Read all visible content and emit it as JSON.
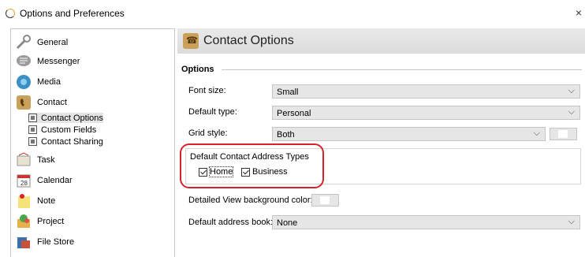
{
  "window": {
    "title": "Options and Preferences",
    "close_glyph": "×"
  },
  "sidebar": {
    "items": [
      {
        "label": "General",
        "icon": "wrench-icon"
      },
      {
        "label": "Messenger",
        "icon": "speech-bubble-icon"
      },
      {
        "label": "Media",
        "icon": "media-icon"
      },
      {
        "label": "Contact",
        "icon": "phone-book-icon"
      },
      {
        "label": "Task",
        "icon": "task-icon"
      },
      {
        "label": "Calendar",
        "icon": "calendar-icon"
      },
      {
        "label": "Note",
        "icon": "note-icon"
      },
      {
        "label": "Project",
        "icon": "project-icon"
      },
      {
        "label": "File Store",
        "icon": "file-store-icon"
      }
    ],
    "contact_sub": [
      {
        "label": "Contact Options",
        "selected": true
      },
      {
        "label": "Custom Fields"
      },
      {
        "label": "Contact Sharing"
      }
    ]
  },
  "content": {
    "header_title": "Contact Options",
    "section_label": "Options",
    "font_size": {
      "label": "Font size:",
      "value": "Small"
    },
    "default_type": {
      "label": "Default type:",
      "value": "Personal"
    },
    "grid_style": {
      "label": "Grid style:",
      "value": "Both"
    },
    "address_types": {
      "title": "Default Contact Address Types",
      "home": {
        "label": "Home",
        "checked": true
      },
      "business": {
        "label": "Business",
        "checked": true
      }
    },
    "detailed_bg_label": "Detailed View background color:",
    "default_address_book": {
      "label": "Default address book:",
      "value": "None"
    }
  },
  "colors": {
    "highlight": "#d4232a",
    "header_bg": "#e2e2e2",
    "select_bg": "#e6e6e6"
  },
  "chevron": "⌵"
}
